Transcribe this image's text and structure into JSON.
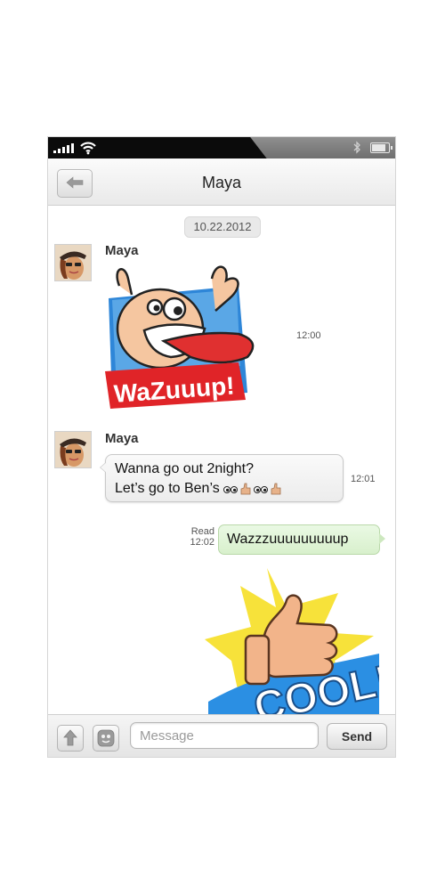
{
  "header": {
    "title": "Maya"
  },
  "date_divider": "10.22.2012",
  "messages": [
    {
      "sender": "Maya",
      "type": "sticker",
      "sticker_text": "WaZuuup!",
      "time": "12:00"
    },
    {
      "sender": "Maya",
      "type": "text",
      "lines": [
        "Wanna go out 2night?",
        "Let’s go to Ben’s"
      ],
      "time": "12:01"
    },
    {
      "sender": "me",
      "type": "text",
      "text": "Wazzzuuuuuuuuup",
      "status": "Read",
      "time": "12:02"
    },
    {
      "sender": "me",
      "type": "sticker",
      "sticker_text": "COOL!"
    }
  ],
  "composer": {
    "placeholder": "Message",
    "send_label": "Send"
  },
  "icons": {
    "back": "arrow-left-icon",
    "attach": "arrow-up-icon",
    "emoji": "smiley-icon",
    "wifi": "wifi-icon",
    "bluetooth": "bluetooth-icon",
    "battery": "battery-icon",
    "signal": "signal-bars-icon"
  },
  "colors": {
    "incoming_bubble": "#f0f0f0",
    "outgoing_bubble": "#dff3d5",
    "status_bar": "#0b0b0b"
  }
}
